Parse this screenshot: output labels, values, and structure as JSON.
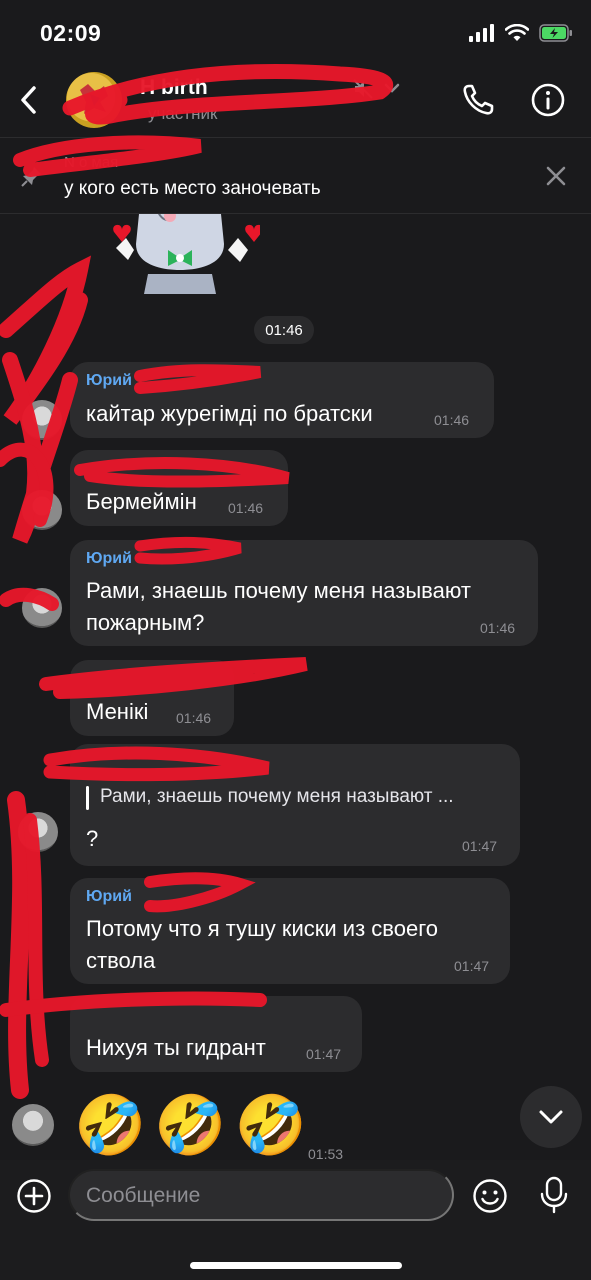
{
  "status_bar": {
    "time": "02:09"
  },
  "header": {
    "title": "H                  birth",
    "subtitle": "участник"
  },
  "pinned": {
    "author": "         N           о мая",
    "text": "у кого есть место заночевать"
  },
  "time_divider": "01:46",
  "messages": [
    {
      "author": "Юрий",
      "text": "кайтар журегімді по братски",
      "time": "01:46"
    },
    {
      "author": "",
      "text": "Бермеймін",
      "time": "01:46"
    },
    {
      "author": "Юрий",
      "text": "Рами, знаешь почему меня называют пожарным?",
      "line1": "Рами, знаешь почему меня называют",
      "line2": "пожарным?",
      "time": "01:46"
    },
    {
      "author": "",
      "text": "Менікі",
      "time": "01:46"
    },
    {
      "author": "",
      "reply_quote": "Рами, знаешь почему меня называют ...",
      "text": "?",
      "time": "01:47"
    },
    {
      "author": "Юрий",
      "line1": "Потому что я тушу киски из своего",
      "line2": "ствола",
      "time": "01:47"
    },
    {
      "author": "",
      "text": "Нихуя ты гидрант",
      "time": "01:47"
    }
  ],
  "emoji_message": {
    "emojis": [
      "🤣",
      "🤣",
      "🤣"
    ],
    "time": "01:53"
  },
  "composer": {
    "placeholder": "Сообщение"
  },
  "colors": {
    "background": "#1a1a1c",
    "bubble": "#2c2c2e",
    "author": "#5fa8f2",
    "redaction": "#e8172a"
  }
}
